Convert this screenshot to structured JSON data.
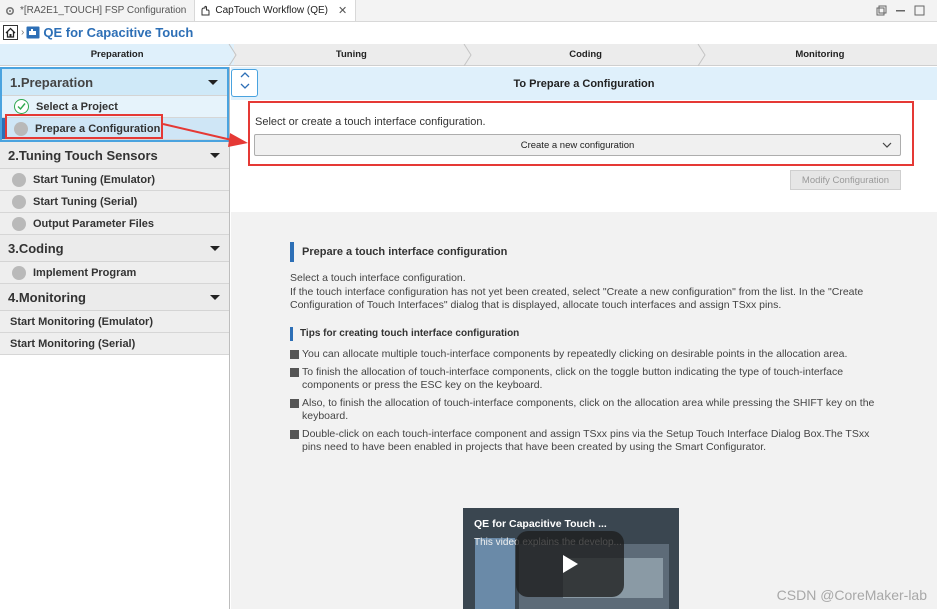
{
  "tabs": [
    {
      "label": "*[RA2E1_TOUCH] FSP Configuration",
      "icon": "gear-icon",
      "active": false
    },
    {
      "label": "CapTouch Workflow (QE)",
      "icon": "captouch-icon",
      "active": true,
      "close": "✕"
    }
  ],
  "header": {
    "title": "QE for Capacitive Touch",
    "title_color": "#2d6fb6"
  },
  "steps": [
    {
      "label": "Preparation",
      "active": true
    },
    {
      "label": "Tuning",
      "active": false
    },
    {
      "label": "Coding",
      "active": false
    },
    {
      "label": "Monitoring",
      "active": false
    }
  ],
  "sidebar": {
    "sections": [
      {
        "label": "1.Preparation",
        "items": [
          {
            "label": "Select a Project",
            "state": "done"
          },
          {
            "label": "Prepare a Configuration",
            "state": "current"
          }
        ]
      },
      {
        "label": "2.Tuning Touch Sensors",
        "items": [
          {
            "label": "Start Tuning (Emulator)"
          },
          {
            "label": "Start Tuning (Serial)"
          },
          {
            "label": "Output Parameter Files"
          }
        ]
      },
      {
        "label": "3.Coding",
        "items": [
          {
            "label": "Implement Program"
          }
        ]
      },
      {
        "label": "4.Monitoring",
        "items": [
          {
            "label": "Start Monitoring (Emulator)"
          },
          {
            "label": "Start Monitoring (Serial)"
          }
        ]
      }
    ]
  },
  "main": {
    "panel_title": "To Prepare a Configuration",
    "select_label": "Select or create a touch interface configuration.",
    "combo_value": "Create a new configuration",
    "modify_button": "Modify Configuration",
    "help": {
      "heading": "Prepare a touch interface configuration",
      "intro_line1": "Select a touch interface configuration.",
      "intro_line2": "If the touch interface configuration has not yet been created, select \"Create a new configuration\" from the list. In the \"Create Configuration of Touch Interfaces\" dialog that is displayed, allocate touch interfaces and assign TSxx pins.",
      "tips_heading": "Tips for creating touch interface configuration",
      "tips": [
        "You can allocate multiple touch-interface components by repeatedly clicking on desirable points in the allocation area.",
        "To finish the allocation of touch-interface components, click on the toggle button indicating the type of touch-interface components or press the ESC key on the keyboard.",
        "Also, to finish the allocation of touch-interface components, click on the allocation area while pressing the SHIFT key on the keyboard.",
        "Double-click on each touch-interface component and assign TSxx pins via the Setup Touch Interface Dialog Box.The TSxx pins need to have been enabled in projects that have been created by using the Smart Configurator."
      ]
    },
    "video": {
      "title": "QE for Capacitive Touch ...",
      "subtitle": "This video explains the develop..."
    }
  },
  "watermark": "CSDN @CoreMaker-lab",
  "colors": {
    "accent": "#2d6fb6",
    "highlight": "#e53935",
    "active_step": "#dff0fb"
  }
}
